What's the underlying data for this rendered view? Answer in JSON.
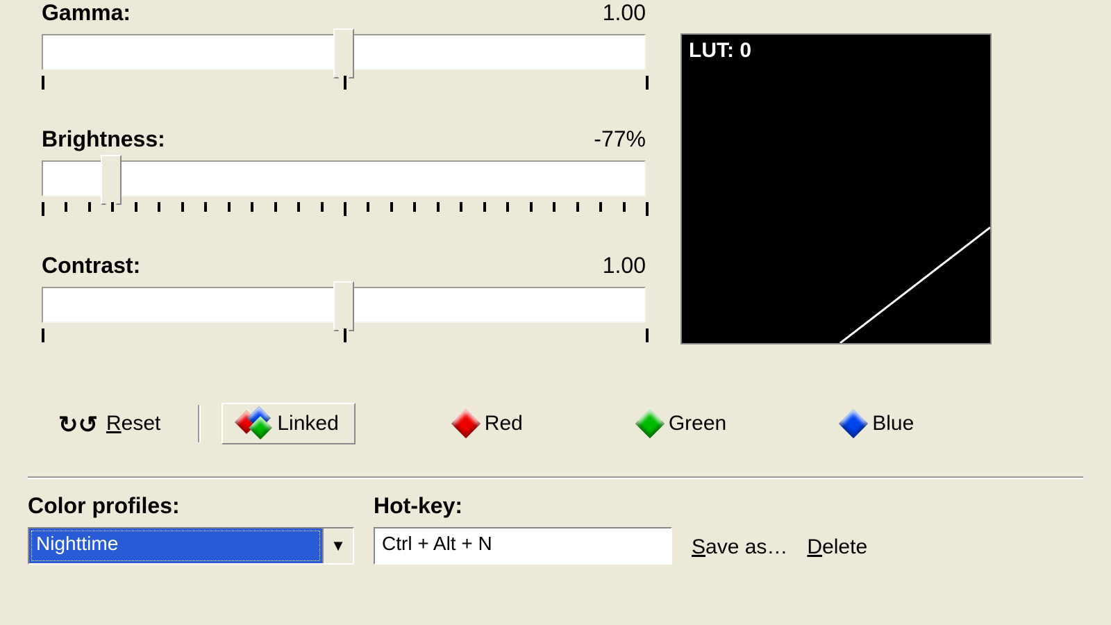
{
  "sliders": {
    "gamma": {
      "label": "Gamma:",
      "value": "1.00",
      "percent": 50,
      "ticks": [
        0,
        50,
        100
      ]
    },
    "brightness": {
      "label": "Brightness:",
      "value": "-77%",
      "percent": 11.5,
      "ticks": [
        0,
        3.85,
        7.69,
        11.5,
        15.4,
        19.2,
        23.1,
        26.9,
        30.8,
        34.6,
        38.5,
        42.3,
        46.2,
        50,
        53.8,
        57.7,
        61.5,
        65.4,
        69.2,
        73.1,
        76.9,
        80.8,
        84.6,
        88.5,
        92.3,
        96.2,
        100
      ]
    },
    "contrast": {
      "label": "Contrast:",
      "value": "1.00",
      "percent": 50,
      "ticks": [
        0,
        50,
        100
      ]
    }
  },
  "lut": {
    "label": "LUT: 0"
  },
  "buttons": {
    "reset": "Reset",
    "linked": "Linked",
    "red": "Red",
    "green": "Green",
    "blue": "Blue"
  },
  "profiles": {
    "label": "Color profiles:",
    "selected": "Nighttime"
  },
  "hotkey": {
    "label": "Hot-key:",
    "value": "Ctrl + Alt + N"
  },
  "actions": {
    "saveas": "Save as…",
    "delete": "Delete"
  }
}
